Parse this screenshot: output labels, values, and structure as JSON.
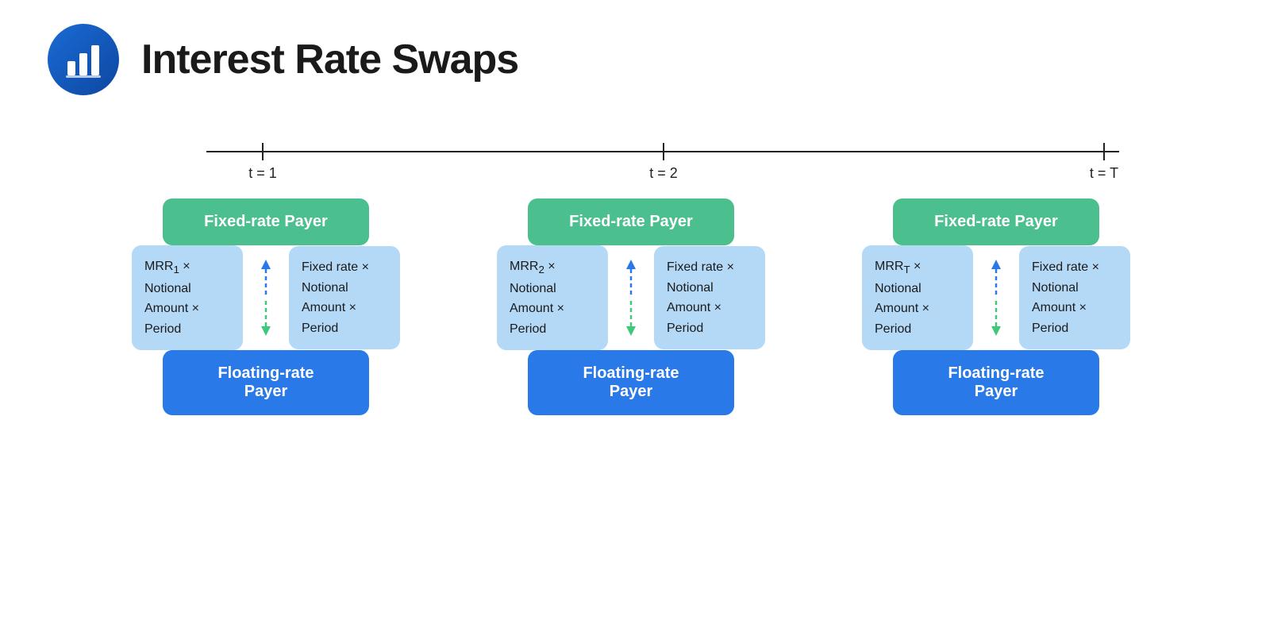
{
  "header": {
    "title": "Interest Rate Swaps",
    "logo_alt": "bar-chart-icon"
  },
  "timeline": {
    "points": [
      {
        "label": "t = 1",
        "position": 22
      },
      {
        "label": "t = 2",
        "position": 51
      },
      {
        "label": "t = T",
        "position": 80
      }
    ]
  },
  "swaps": [
    {
      "id": 1,
      "fixed_payer_label": "Fixed-rate Payer",
      "floating_payer_label": "Floating-rate\nPayer",
      "mrr_box": "MRR₁ ×\nNotional\nAmount ×\nPeriod",
      "mrr_sub": "1",
      "fixed_box": "Fixed rate ×\nNotional\nAmount ×\nPeriod"
    },
    {
      "id": 2,
      "fixed_payer_label": "Fixed-rate Payer",
      "floating_payer_label": "Floating-rate\nPayer",
      "mrr_box": "MRR₂ ×\nNotional\nAmount ×\nPeriod",
      "mrr_sub": "2",
      "fixed_box": "Fixed rate ×\nNotional\nAmount ×\nPeriod"
    },
    {
      "id": 3,
      "fixed_payer_label": "Fixed-rate Payer",
      "floating_payer_label": "Floating-rate\nPayer",
      "mrr_box": "MRRₜ ×\nNotional\nAmount ×\nPeriod",
      "mrr_sub": "T",
      "fixed_box": "Fixed rate ×\nNotional\nAmount ×\nPeriod"
    }
  ],
  "colors": {
    "fixed_payer_bg": "#4cbf8e",
    "floating_payer_bg": "#2979e8",
    "info_box_bg": "#b3d9f7",
    "arrow_blue": "#2979e8",
    "arrow_green": "#3ec87a",
    "timeline_color": "#222222",
    "logo_gradient_start": "#1a6bd4",
    "logo_gradient_end": "#0d47a1",
    "title_color": "#1a1a1a"
  }
}
